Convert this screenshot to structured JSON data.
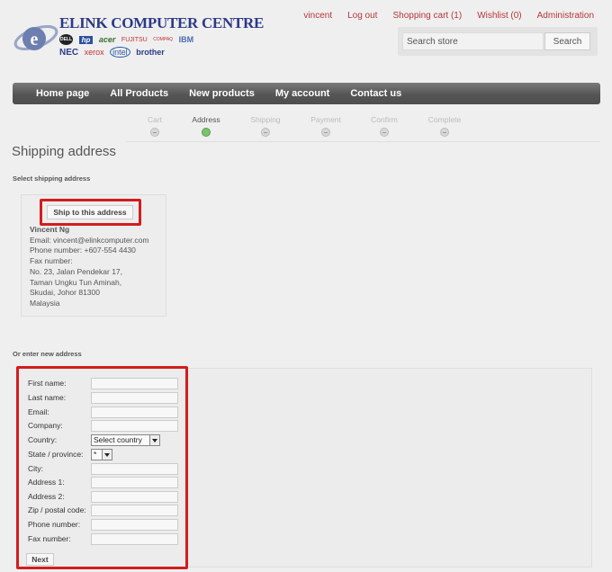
{
  "header": {
    "brand_title": "ELINK COMPUTER CENTRE",
    "brands_row1": [
      "DELL",
      "hp",
      "acer",
      "FUJITSU",
      "COMPAQ",
      "IBM"
    ],
    "brands_row2": [
      "NEC",
      "xerox",
      "intel",
      "brother"
    ],
    "links": {
      "user": "vincent",
      "logout": "Log out",
      "cart": "Shopping cart (1)",
      "wishlist": "Wishlist (0)",
      "admin": "Administration"
    },
    "search": {
      "placeholder": "Search store",
      "button": "Search"
    }
  },
  "nav": {
    "home": "Home page",
    "all_products": "All Products",
    "new_products": "New products",
    "account": "My account",
    "contact": "Contact us"
  },
  "steps": [
    {
      "label": "Cart",
      "active": false
    },
    {
      "label": "Address",
      "active": true
    },
    {
      "label": "Shipping",
      "active": false
    },
    {
      "label": "Payment",
      "active": false
    },
    {
      "label": "Confirm",
      "active": false
    },
    {
      "label": "Complete",
      "active": false
    }
  ],
  "page_title": "Shipping address",
  "select_section_title": "Select shipping address",
  "existing_address": {
    "ship_button": "Ship to this address",
    "name": "Vincent Ng",
    "email": "Email: vincent@elinkcomputer.com",
    "phone": "Phone number: +607-554 4430",
    "fax": "Fax number:",
    "line1": "No. 23, Jalan Pendekar 17,",
    "line2": "Taman Ungku Tun Aminah,",
    "line3": "Skudai, Johor 81300",
    "line4": "Malaysia"
  },
  "new_section_title": "Or enter new address",
  "form": {
    "first_name": "First name:",
    "last_name": "Last name:",
    "email": "Email:",
    "company": "Company:",
    "country": "Country:",
    "country_value": "Select country",
    "state": "State / province:",
    "state_value": "*",
    "city": "City:",
    "address1": "Address 1:",
    "address2": "Address 2:",
    "zip": "Zip / postal code:",
    "phone": "Phone number:",
    "fax": "Fax number:",
    "next": "Next"
  },
  "colors": {
    "link": "#b5363a",
    "highlight": "#d21d1d",
    "nav": "#5a5a5a",
    "active_step": "#7bc46b"
  }
}
